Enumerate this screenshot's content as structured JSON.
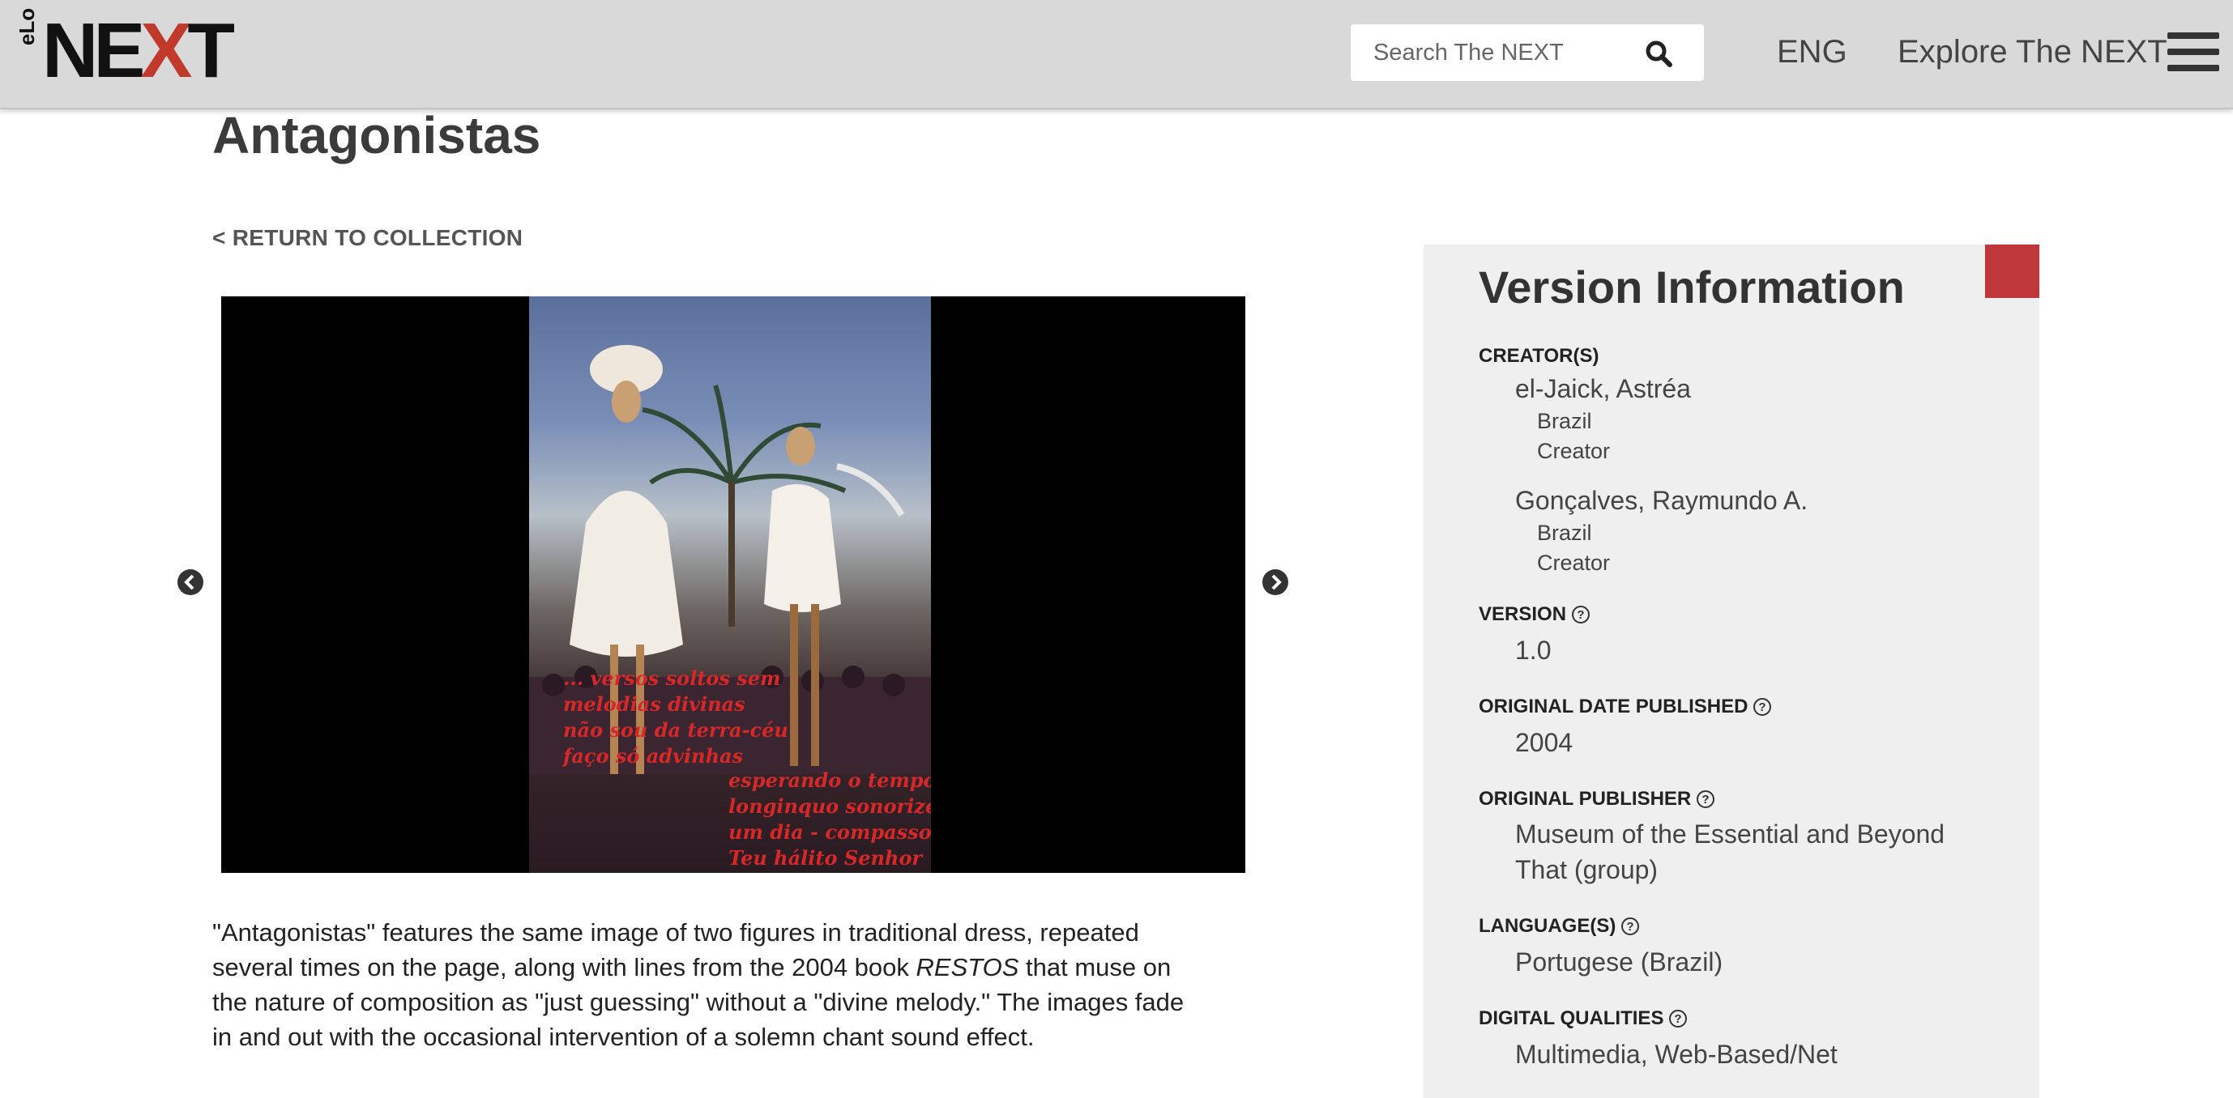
{
  "header": {
    "logo_prefix": "eLo",
    "logo_word_left": "NE",
    "logo_word_x": "X",
    "logo_word_right": "T",
    "search_placeholder": "Search The NEXT",
    "language": "ENG",
    "explore_label": "Explore The NEXT",
    "icons": [
      "search-icon",
      "hamburger-menu-icon"
    ]
  },
  "page": {
    "title": "Antagonistas",
    "return_link": "< RETURN TO COLLECTION"
  },
  "gallery": {
    "verse_left": "... versos soltos sem\nmelodias divinas\nnão sou da terra-céu\nfaço só advinhas",
    "verse_right": "esperando o tempo\nlonginquo sonorize\num dia - compasso\nTeu hálito Senhor",
    "icons": [
      "arrow-left-icon",
      "arrow-right-icon"
    ]
  },
  "description": {
    "part1": "\"Antagonistas\" features the same image of two figures in traditional dress, repeated several times on the page, along with lines from the 2004 book ",
    "book_title": "RESTOS",
    "part2": " that muse on the nature of composition as \"just guessing\" without a \"divine melody.\" The images fade in and out with the occasional intervention of a solemn chant sound effect."
  },
  "version_info": {
    "title": "Version Information",
    "creators_label": "CREATOR(S)",
    "creators": [
      {
        "name": "el-Jaick, Astréa",
        "country": "Brazil",
        "role": "Creator"
      },
      {
        "name": "Gonçalves, Raymundo A.",
        "country": "Brazil",
        "role": "Creator"
      }
    ],
    "version_label": "VERSION",
    "version": "1.0",
    "date_label": "ORIGINAL DATE PUBLISHED",
    "date": "2004",
    "publisher_label": "ORIGINAL PUBLISHER",
    "publisher_line1": "Museum of the Essential and Beyond",
    "publisher_line2": "That (group)",
    "languages_label": "LANGUAGE(S)",
    "languages": "Portugese (Brazil)",
    "digital_label": "DIGITAL QUALITIES",
    "digital": "Multimedia, Web-Based/Net"
  },
  "colors": {
    "header_bg": "#d9d9d9",
    "accent_red": "#c0373b",
    "panel_bg": "#efefef"
  }
}
